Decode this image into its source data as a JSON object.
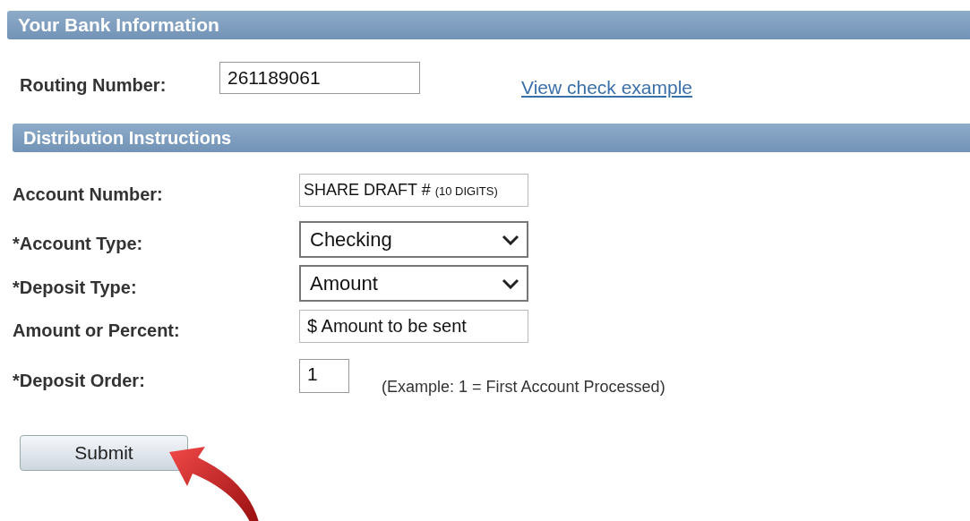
{
  "bank_section": {
    "title": "Your Bank Information"
  },
  "routing": {
    "label": "Routing Number:",
    "value": "261189061",
    "link": "View check example"
  },
  "distribution_section": {
    "title": "Distribution Instructions"
  },
  "fields": [
    {
      "kind": "text",
      "label": "Account Number:",
      "value": "SHARE DRAFT #",
      "note": "(10 DIGITS)"
    },
    {
      "kind": "select",
      "label": "*Account Type:",
      "value": "Checking"
    },
    {
      "kind": "select",
      "label": "*Deposit Type:",
      "value": "Amount"
    },
    {
      "kind": "text",
      "label": "Amount or Percent:",
      "value": "$ Amount to be sent"
    },
    {
      "kind": "short",
      "label": "*Deposit Order:",
      "value": "1",
      "hint": "(Example: 1 = First Account Processed)"
    }
  ],
  "submit": "Submit"
}
